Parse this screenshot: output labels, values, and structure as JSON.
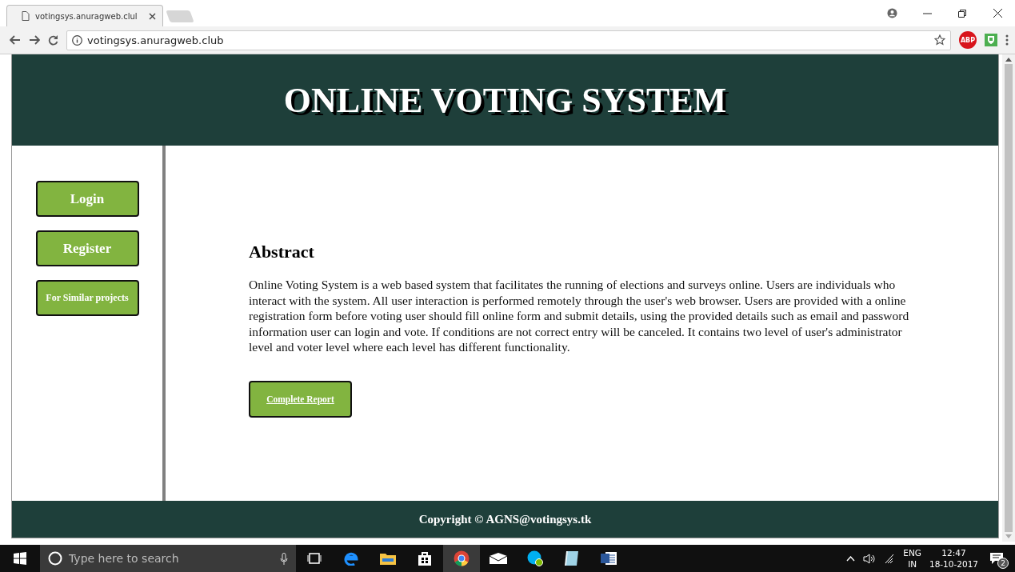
{
  "browser": {
    "tab_title": "votingsys.anuragweb.clul",
    "address": "votingsys.anuragweb.club",
    "adblock_label": "ABP"
  },
  "page": {
    "title": "ONLINE VOTING SYSTEM",
    "sidebar": [
      {
        "label": "Login",
        "kind": "large"
      },
      {
        "label": "Register",
        "kind": "large"
      },
      {
        "label": "For Similar projects",
        "kind": "small"
      }
    ],
    "abstract": {
      "heading": "Abstract",
      "text": "Online Voting System is a web based system that facilitates the running of elections and surveys online. Users are individuals who interact with the system. All user interaction is performed remotely through the user's web browser. Users are provided with a online registration form before voting user should fill online form and submit details, using the provided details such as email and password information user can login and vote. If conditions are not correct entry will be canceled. It contains two level of user's administrator level and voter level where each level has different functionality."
    },
    "report_link": "Complete Report",
    "footer": "Copyright © AGNS@votingsys.tk"
  },
  "taskbar": {
    "search_placeholder": "Type here to search",
    "language": "ENG",
    "region": "IN",
    "time": "12:47",
    "date": "18-10-2017",
    "notifications": "2"
  }
}
